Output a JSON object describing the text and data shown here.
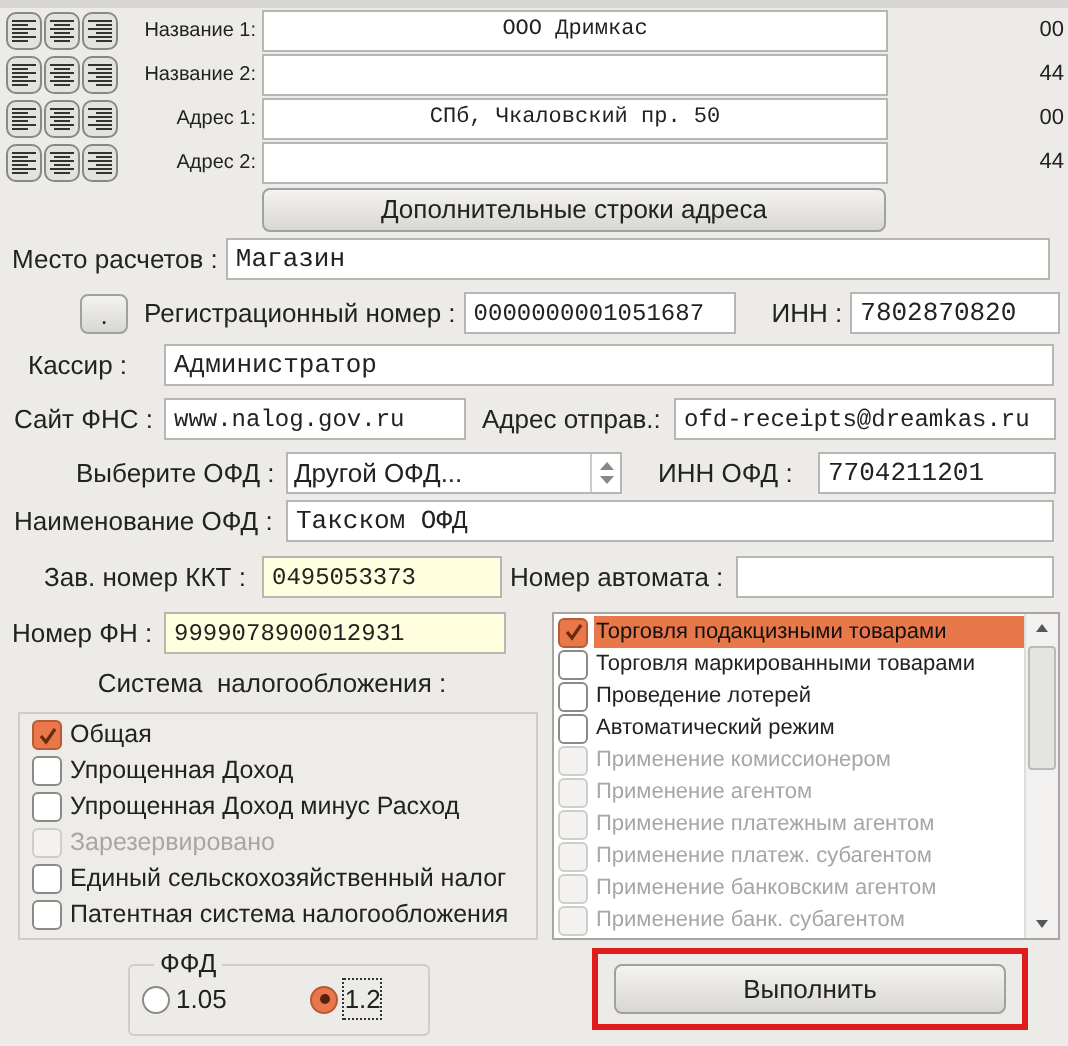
{
  "header_rows": [
    {
      "label": "Название 1:",
      "value": "ООО Дримкас",
      "trailing": "00"
    },
    {
      "label": "Название 2:",
      "trailing": "44"
    },
    {
      "label": "Адрес 1:",
      "value": "СПб, Чкаловский пр. 50",
      "trailing": "00"
    },
    {
      "label": "Адрес 2:",
      "trailing": "44"
    }
  ],
  "extra_address_button": "Дополнительные строки адреса",
  "place": {
    "label": "Место расчетов :",
    "value": "Магазин"
  },
  "reg_button": ".",
  "reg_number": {
    "label": "Регистрационный номер :",
    "value": "0000000001051687"
  },
  "inn": {
    "label": "ИНН :",
    "value": "7802870820"
  },
  "cashier": {
    "label": "Кассир  :",
    "value": "Администратор"
  },
  "fns_site": {
    "label": "Сайт ФНС :",
    "value": "www.nalog.gov.ru"
  },
  "sender_address": {
    "label": "Адрес отправ.:",
    "value": "ofd-receipts@dreamkas.ru"
  },
  "ofd_select": {
    "label": "Выберите ОФД :",
    "value": "Другой ОФД..."
  },
  "ofd_inn": {
    "label": "ИНН ОФД :",
    "value": "7704211201"
  },
  "ofd_name": {
    "label": "Наименование ОФД :",
    "value": "Такском ОФД"
  },
  "kkt_serial": {
    "label": "Зав. номер ККТ :",
    "value": "0495053373",
    "highlighted": true
  },
  "machine_number": {
    "label": "Номер автомата :"
  },
  "fn_number": {
    "label": "Номер ФН :",
    "value": "9999078900012931",
    "highlighted": true
  },
  "tax_system": {
    "title": "Система  налогообложения :",
    "options": [
      {
        "label": "Общая",
        "checked": true,
        "disabled": false
      },
      {
        "label": "Упрощенная Доход",
        "checked": false,
        "disabled": false
      },
      {
        "label": "Упрощенная Доход минус Расход",
        "checked": false,
        "disabled": false
      },
      {
        "label": "Зарезервировано",
        "checked": false,
        "disabled": true
      },
      {
        "label": "Единый сельскохозяйственный налог",
        "checked": false,
        "disabled": false
      },
      {
        "label": "Патентная система налогообложения",
        "checked": false,
        "disabled": false
      }
    ]
  },
  "features": [
    {
      "label": "Торговля подакцизными товарами",
      "checked": true,
      "disabled": false,
      "selected": true
    },
    {
      "label": "Торговля маркированными товарами",
      "checked": false,
      "disabled": false,
      "selected": false
    },
    {
      "label": "Проведение лотерей",
      "checked": false,
      "disabled": false,
      "selected": false
    },
    {
      "label": "Автоматический режим",
      "checked": false,
      "disabled": false,
      "selected": false
    },
    {
      "label": "Применение комиссионером",
      "checked": false,
      "disabled": true,
      "selected": false
    },
    {
      "label": "Применение агентом",
      "checked": false,
      "disabled": true,
      "selected": false
    },
    {
      "label": "Применение платежным агентом",
      "checked": false,
      "disabled": true,
      "selected": false
    },
    {
      "label": "Применение платеж. субагентом",
      "checked": false,
      "disabled": true,
      "selected": false
    },
    {
      "label": "Применение банковским агентом",
      "checked": false,
      "disabled": true,
      "selected": false
    },
    {
      "label": "Применение банк. субагентом",
      "checked": false,
      "disabled": true,
      "selected": false
    }
  ],
  "ffd": {
    "title": "ФФД",
    "options": [
      {
        "label": "1.05",
        "selected": false
      },
      {
        "label": "1.2",
        "selected": true
      }
    ]
  },
  "run_button": "Выполнить"
}
